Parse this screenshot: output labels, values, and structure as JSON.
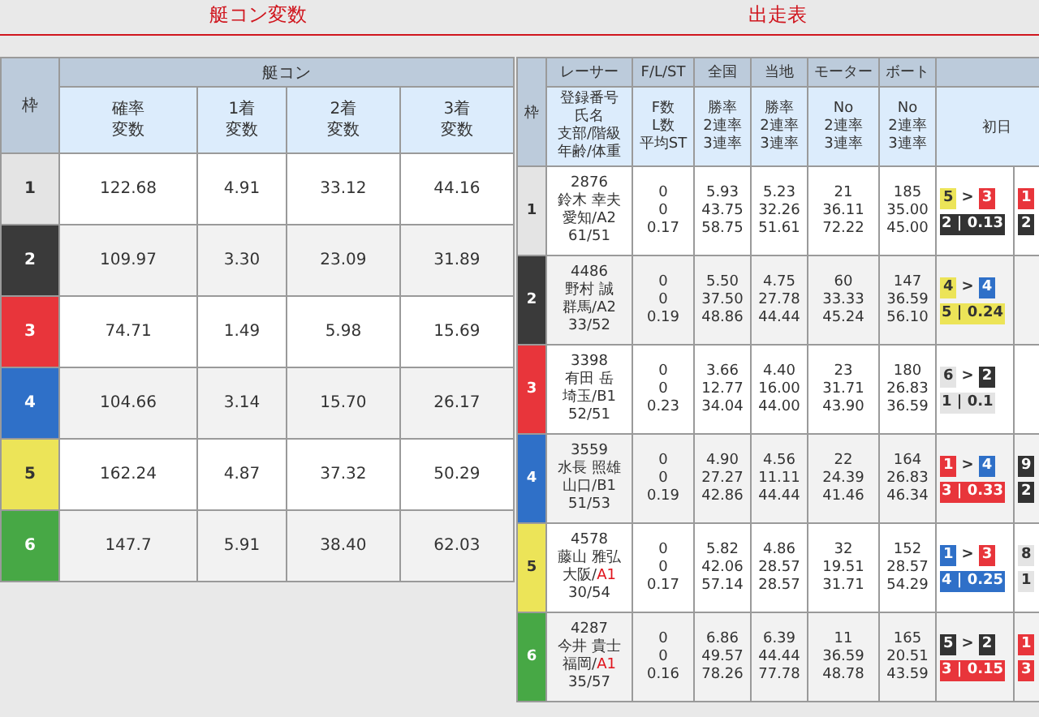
{
  "left_title": "艇コン変数",
  "right_title": "出走表",
  "boatcon": {
    "frame_header": "枠",
    "group_header": "艇コン",
    "columns": [
      [
        "確率",
        "変数"
      ],
      [
        "1着",
        "変数"
      ],
      [
        "2着",
        "変数"
      ],
      [
        "3着",
        "変数"
      ]
    ],
    "rows": [
      {
        "frame": "1",
        "color": "#e4e4e4",
        "values": [
          "122.68",
          "4.91",
          "33.12",
          "44.16"
        ]
      },
      {
        "frame": "2",
        "color": "#3a3a3a",
        "values": [
          "109.97",
          "3.30",
          "23.09",
          "31.89"
        ]
      },
      {
        "frame": "3",
        "color": "#e8353b",
        "values": [
          "74.71",
          "1.49",
          "5.98",
          "15.69"
        ]
      },
      {
        "frame": "4",
        "color": "#2f70c8",
        "values": [
          "104.66",
          "3.14",
          "15.70",
          "26.17"
        ]
      },
      {
        "frame": "5",
        "color": "#ece458",
        "values": [
          "162.24",
          "4.87",
          "37.32",
          "50.29"
        ]
      },
      {
        "frame": "6",
        "color": "#47a845",
        "values": [
          "147.7",
          "5.91",
          "38.40",
          "62.03"
        ]
      }
    ]
  },
  "entry": {
    "frame_header": "枠",
    "day_header": "初日",
    "columns": [
      {
        "title": "レーサー",
        "sub": [
          "登録番号",
          "氏名",
          "支部/階級",
          "年齢/体重"
        ]
      },
      {
        "title": "F/L/ST",
        "sub": [
          "F数",
          "L数",
          "平均ST"
        ]
      },
      {
        "title": "全国",
        "sub": [
          "勝率",
          "2連率",
          "3連率"
        ]
      },
      {
        "title": "当地",
        "sub": [
          "勝率",
          "2連率",
          "3連率"
        ]
      },
      {
        "title": "モーター",
        "sub": [
          "No",
          "2連率",
          "3連率"
        ]
      },
      {
        "title": "ボート",
        "sub": [
          "No",
          "2連率",
          "3連率"
        ]
      }
    ],
    "rows": [
      {
        "frame": "1",
        "color": "#e4e4e4",
        "racer": {
          "id": "2876",
          "name": "鈴木 幸夫",
          "branch": "愛知/",
          "rank": "A2",
          "rank_highlight": false,
          "age_weight": "61/51"
        },
        "stats": [
          "0\n0\n0.17",
          "5.93\n43.75\n58.75",
          "5.23\n32.26\n51.61",
          "21\n36.11\n72.22",
          "185\n35.00\n45.00"
        ],
        "day1": {
          "from": {
            "text": "5",
            "color": "#ece458"
          },
          "arrow": ">",
          "to": {
            "text": "3",
            "color": "#e8353b"
          },
          "result": {
            "text": "2 | 0.13",
            "color": "#333333"
          }
        },
        "day2": {
          "from": {
            "text": "1",
            "color": "#e8353b"
          },
          "result": {
            "text": "2",
            "color": "#333333"
          }
        }
      },
      {
        "frame": "2",
        "color": "#3a3a3a",
        "racer": {
          "id": "4486",
          "name": "野村 誠",
          "branch": "群馬/",
          "rank": "A2",
          "rank_highlight": false,
          "age_weight": "33/52"
        },
        "stats": [
          "0\n0\n0.19",
          "5.50\n37.50\n48.86",
          "4.75\n27.78\n44.44",
          "60\n33.33\n45.24",
          "147\n36.59\n56.10"
        ],
        "day1": {
          "from": {
            "text": "4",
            "color": "#ece458"
          },
          "arrow": ">",
          "to": {
            "text": "4",
            "color": "#2f70c8"
          },
          "result": {
            "text": "5 | 0.24",
            "color": "#ece458"
          }
        }
      },
      {
        "frame": "3",
        "color": "#e8353b",
        "racer": {
          "id": "3398",
          "name": "有田 岳",
          "branch": "埼玉/",
          "rank": "B1",
          "rank_highlight": false,
          "age_weight": "52/51"
        },
        "stats": [
          "0\n0\n0.23",
          "3.66\n12.77\n34.04",
          "4.40\n16.00\n44.00",
          "23\n31.71\n43.90",
          "180\n26.83\n36.59"
        ],
        "day1": {
          "from": {
            "text": "6",
            "color": "#e4e4e4"
          },
          "arrow": ">",
          "to": {
            "text": "2",
            "color": "#333333"
          },
          "result": {
            "text": "1 | 0.1",
            "color": "#e4e4e4"
          }
        }
      },
      {
        "frame": "4",
        "color": "#2f70c8",
        "racer": {
          "id": "3559",
          "name": "水長 照雄",
          "branch": "山口/",
          "rank": "B1",
          "rank_highlight": false,
          "age_weight": "51/53"
        },
        "stats": [
          "0\n0\n0.19",
          "4.90\n27.27\n42.86",
          "4.56\n11.11\n44.44",
          "22\n24.39\n41.46",
          "164\n26.83\n46.34"
        ],
        "day1": {
          "from": {
            "text": "1",
            "color": "#e8353b"
          },
          "arrow": ">",
          "to": {
            "text": "4",
            "color": "#2f70c8"
          },
          "result": {
            "text": "3 | 0.33",
            "color": "#e8353b"
          }
        },
        "day2": {
          "from": {
            "text": "9",
            "color": "#333333"
          },
          "result": {
            "text": "2",
            "color": "#333333"
          }
        }
      },
      {
        "frame": "5",
        "color": "#ece458",
        "racer": {
          "id": "4578",
          "name": "藤山 雅弘",
          "branch": "大阪/",
          "rank": "A1",
          "rank_highlight": true,
          "age_weight": "30/54"
        },
        "stats": [
          "0\n0\n0.17",
          "5.82\n42.06\n57.14",
          "4.86\n28.57\n28.57",
          "32\n19.51\n31.71",
          "152\n28.57\n54.29"
        ],
        "day1": {
          "from": {
            "text": "1",
            "color": "#2f70c8"
          },
          "arrow": ">",
          "to": {
            "text": "3",
            "color": "#e8353b"
          },
          "result": {
            "text": "4 | 0.25",
            "color": "#2f70c8"
          }
        },
        "day2": {
          "from": {
            "text": "8",
            "color": "#e4e4e4"
          },
          "result": {
            "text": "1",
            "color": "#e4e4e4"
          }
        }
      },
      {
        "frame": "6",
        "color": "#47a845",
        "racer": {
          "id": "4287",
          "name": "今井 貴士",
          "branch": "福岡/",
          "rank": "A1",
          "rank_highlight": true,
          "age_weight": "35/57"
        },
        "stats": [
          "0\n0\n0.16",
          "6.86\n49.57\n78.26",
          "6.39\n44.44\n77.78",
          "11\n36.59\n48.78",
          "165\n20.51\n43.59"
        ],
        "day1": {
          "from": {
            "text": "5",
            "color": "#333333"
          },
          "arrow": ">",
          "to": {
            "text": "2",
            "color": "#333333"
          },
          "result": {
            "text": "3 | 0.15",
            "color": "#e8353b"
          }
        },
        "day2": {
          "from": {
            "text": "1",
            "color": "#e8353b"
          },
          "result": {
            "text": "3",
            "color": "#e8353b"
          }
        }
      }
    ]
  }
}
